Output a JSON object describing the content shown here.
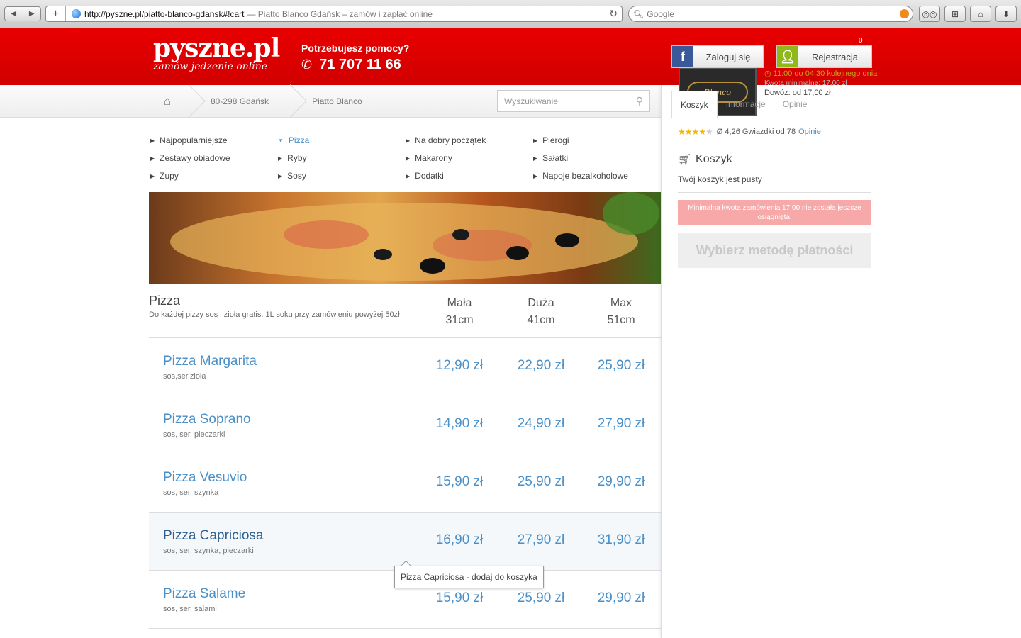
{
  "browser": {
    "url": "http://pyszne.pl/piatto-blanco-gdansk#!cart",
    "page_title": "— Piatto Blanco Gdańsk – zamów i zapłać online",
    "search_placeholder": "Google"
  },
  "header": {
    "logo": "pyszne.pl",
    "tagline": "zamów jedzenie online",
    "help_question": "Potrzebujesz pomocy?",
    "phone": "71 707 11 66",
    "login_label": "Zaloguj się",
    "register_label": "Rejestracja",
    "cart_count": "0"
  },
  "breadcrumb": {
    "items": [
      "80-298 Gdańsk",
      "Piatto Blanco"
    ]
  },
  "search": {
    "placeholder": "Wyszukiwanie"
  },
  "categories": [
    "Najpopularniejsze",
    "Pizza",
    "Na dobry początek",
    "Pierogi",
    "Zestawy obiadowe",
    "Ryby",
    "Makarony",
    "Sałatki",
    "Zupy",
    "Sosy",
    "Dodatki",
    "Napoje bezalkoholowe"
  ],
  "active_category": "Pizza",
  "section": {
    "title": "Pizza",
    "description": "Do każdej pizzy sos i zioła gratis. 1L soku przy zamówieniu powyżej 50zł",
    "columns": [
      {
        "name": "Mała",
        "size": "31cm"
      },
      {
        "name": "Duża",
        "size": "41cm"
      },
      {
        "name": "Max",
        "size": "51cm"
      }
    ]
  },
  "menu_items": [
    {
      "name": "Pizza Margarita",
      "desc": "sos,ser,zioła",
      "prices": [
        "12,90 zł",
        "22,90 zł",
        "25,90 zł"
      ]
    },
    {
      "name": "Pizza Soprano",
      "desc": "sos, ser, pieczarki",
      "prices": [
        "14,90 zł",
        "24,90 zł",
        "27,90 zł"
      ]
    },
    {
      "name": "Pizza Vesuvio",
      "desc": "sos, ser, szynka",
      "prices": [
        "15,90 zł",
        "25,90 zł",
        "29,90 zł"
      ]
    },
    {
      "name": "Pizza Capriciosa",
      "desc": "sos, ser, szynka, pieczarki",
      "prices": [
        "16,90 zł",
        "27,90 zł",
        "31,90 zł"
      ]
    },
    {
      "name": "Pizza Salame",
      "desc": "sos, ser, salami",
      "prices": [
        "15,90 zł",
        "25,90 zł",
        "29,90 zł"
      ]
    }
  ],
  "tooltip": "Pizza Capriciosa - dodaj do koszyka",
  "restaurant": {
    "logo_text": "Blanco",
    "hours": "11:00 do 04:30 kolejnego dnia",
    "min_order": "Kwota minimalna: 17,00 zł",
    "delivery": "Dowóz: od 17,00 zł",
    "tabs": [
      "Koszyk",
      "Informacje",
      "Opinie"
    ],
    "rating_text": "Ø 4,26 Gwiazdki od 78",
    "rating_link": "Opinie",
    "rating": 4.26
  },
  "cart": {
    "title": "Koszyk",
    "empty_text": "Twój koszyk jest pusty",
    "min_warning": "Minimalna kwota zamówienia 17,00 nie została jeszcze osiągnięta.",
    "pay_button": "Wybierz metodę płatności"
  },
  "colors": {
    "brand_red": "#e00000",
    "link_blue": "#4a90c8",
    "facebook": "#3b5998",
    "register_green": "#8fb81a",
    "warning": "#f7a8a8"
  }
}
